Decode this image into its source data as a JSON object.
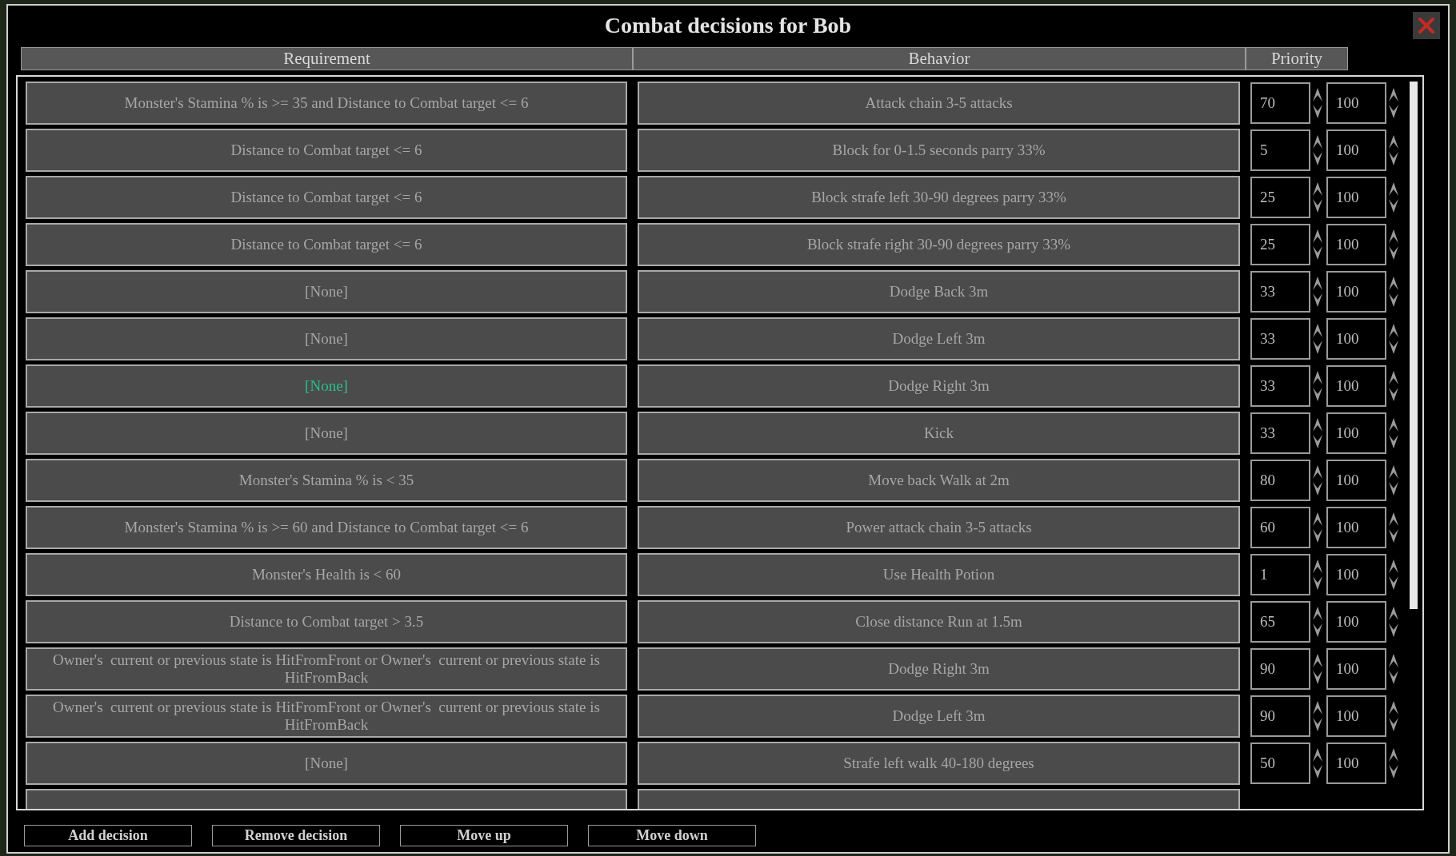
{
  "window": {
    "title": "Combat decisions for Bob"
  },
  "columns": [
    "Requirement",
    "Behavior",
    "Priority"
  ],
  "rows": [
    {
      "requirement": "Monster's Stamina % is >= 35 and Distance to Combat target <= 6",
      "behavior": "Attack chain 3-5 attacks",
      "priority": "70",
      "max": "100",
      "selected": false
    },
    {
      "requirement": "Distance to Combat target <= 6",
      "behavior": "Block for 0-1.5 seconds parry 33%",
      "priority": "5",
      "max": "100",
      "selected": false
    },
    {
      "requirement": "Distance to Combat target <= 6",
      "behavior": "Block strafe left 30-90 degrees parry 33%",
      "priority": "25",
      "max": "100",
      "selected": false
    },
    {
      "requirement": "Distance to Combat target <= 6",
      "behavior": "Block strafe right 30-90 degrees parry 33%",
      "priority": "25",
      "max": "100",
      "selected": false
    },
    {
      "requirement": "[None]",
      "behavior": "Dodge Back 3m",
      "priority": "33",
      "max": "100",
      "selected": false
    },
    {
      "requirement": "[None]",
      "behavior": "Dodge Left 3m",
      "priority": "33",
      "max": "100",
      "selected": false
    },
    {
      "requirement": "[None]",
      "behavior": "Dodge Right 3m",
      "priority": "33",
      "max": "100",
      "selected": true
    },
    {
      "requirement": "[None]",
      "behavior": "Kick",
      "priority": "33",
      "max": "100",
      "selected": false
    },
    {
      "requirement": "Monster's Stamina % is < 35",
      "behavior": "Move back Walk at 2m",
      "priority": "80",
      "max": "100",
      "selected": false
    },
    {
      "requirement": "Monster's Stamina % is >= 60 and Distance to Combat target <= 6",
      "behavior": "Power attack chain 3-5 attacks",
      "priority": "60",
      "max": "100",
      "selected": false
    },
    {
      "requirement": "Monster's Health is < 60",
      "behavior": "Use Health Potion",
      "priority": "1",
      "max": "100",
      "selected": false
    },
    {
      "requirement": "Distance to Combat target > 3.5",
      "behavior": "Close distance Run at 1.5m",
      "priority": "65",
      "max": "100",
      "selected": false
    },
    {
      "requirement": "Owner's  current or previous state is HitFromFront or Owner's  current or previous state is HitFromBack",
      "behavior": "Dodge Right 3m",
      "priority": "90",
      "max": "100",
      "selected": false
    },
    {
      "requirement": "Owner's  current or previous state is HitFromFront or Owner's  current or previous state is HitFromBack",
      "behavior": "Dodge Left 3m",
      "priority": "90",
      "max": "100",
      "selected": false
    },
    {
      "requirement": "[None]",
      "behavior": "Strafe left walk 40-180 degrees",
      "priority": "50",
      "max": "100",
      "selected": false
    }
  ],
  "buttons": [
    "Add decision",
    "Remove decision",
    "Move up",
    "Move down"
  ]
}
